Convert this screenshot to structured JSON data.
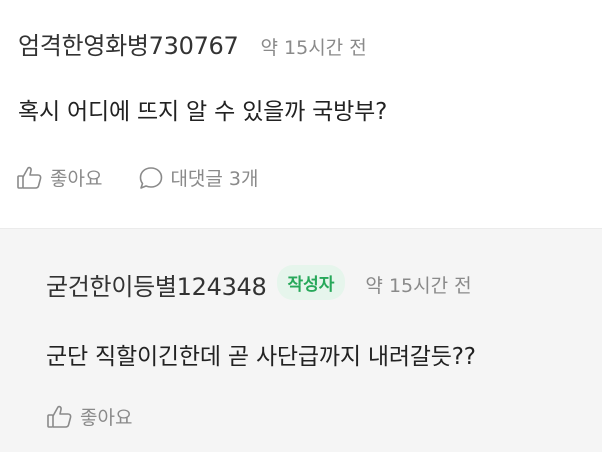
{
  "comment": {
    "author": "엄격한영화병730767",
    "time": "약 15시간 전",
    "text": "혹시 어디에 뜨지 알 수 있을까 국방부?",
    "like_label": "좋아요",
    "reply_label": "대댓글 3개"
  },
  "reply": {
    "author": "굳건한이등별124348",
    "badge": "작성자",
    "time": "약 15시간 전",
    "text": "군단 직할이긴한데 곧 사단급까지 내려갈듯??",
    "like_label": "좋아요"
  }
}
